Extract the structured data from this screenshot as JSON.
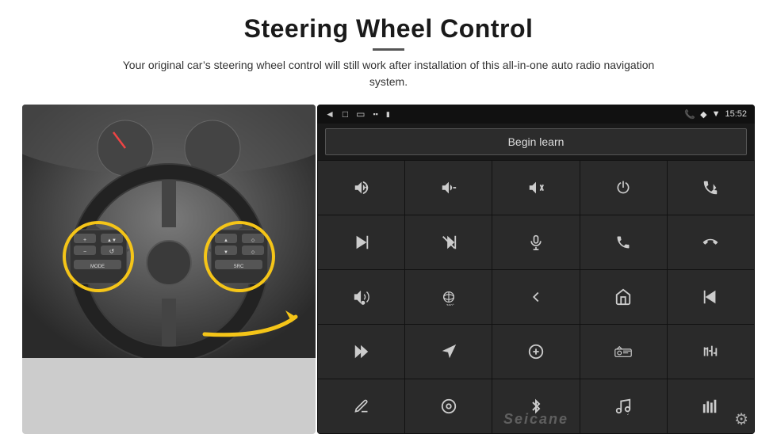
{
  "header": {
    "title": "Steering Wheel Control",
    "divider": true,
    "subtitle": "Your original car’s steering wheel control will still work after installation of this all-in-one auto radio navigation system."
  },
  "android": {
    "status_bar": {
      "back_icon": "◄",
      "home_icon": "□",
      "recent_icon": "□",
      "signal_icon": "✆",
      "location_icon": "◆",
      "wifi_icon": "▼",
      "time": "15:52"
    },
    "begin_learn_label": "Begin learn",
    "controls": [
      {
        "icon": "🔊+",
        "label": "vol-up"
      },
      {
        "icon": "🔊−",
        "label": "vol-down"
      },
      {
        "icon": "🔇",
        "label": "mute"
      },
      {
        "icon": "⏻",
        "label": "power"
      },
      {
        "icon": "☎⏮",
        "label": "call-prev"
      },
      {
        "icon": "⏭",
        "label": "next-track"
      },
      {
        "icon": "✘⏭",
        "label": "skip"
      },
      {
        "icon": "🎤",
        "label": "mic"
      },
      {
        "icon": "☎",
        "label": "phone"
      },
      {
        "icon": "↪",
        "label": "hang-up"
      },
      {
        "icon": "🔔",
        "label": "sound"
      },
      {
        "icon": "🔍",
        "label": "360"
      },
      {
        "icon": "↩",
        "label": "back"
      },
      {
        "icon": "⌂",
        "label": "home"
      },
      {
        "icon": "⏮",
        "label": "prev-track"
      },
      {
        "icon": "⏭⏭",
        "label": "fast-forward"
      },
      {
        "icon": "▶",
        "label": "navigate"
      },
      {
        "icon": "➡",
        "label": "source"
      },
      {
        "icon": "📻",
        "label": "radio"
      },
      {
        "icon": "⫟",
        "label": "equalizer"
      },
      {
        "icon": "✏",
        "label": "pen"
      },
      {
        "icon": "◎",
        "label": "menu"
      },
      {
        "icon": "★",
        "label": "bluetooth"
      },
      {
        "icon": "♫",
        "label": "music"
      },
      {
        "icon": "▊▊▊",
        "label": "levels"
      }
    ],
    "watermark": "Seicane",
    "gear_icon": "⚙"
  }
}
